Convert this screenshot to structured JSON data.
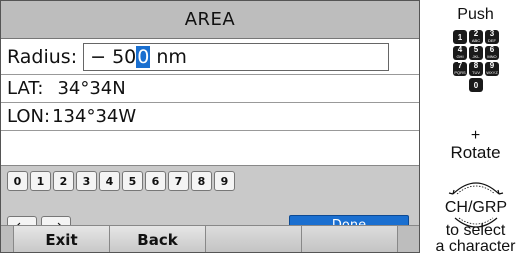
{
  "screen": {
    "title": "AREA",
    "radius_label": "Radius:",
    "radius_value_before": "− 50",
    "radius_value_cursor": "0",
    "radius_unit": " nm",
    "lat_label": "LAT:",
    "lat_value": "34°34N",
    "lon_label": "LON:",
    "lon_value": "134°34W",
    "digits": [
      "0",
      "1",
      "2",
      "3",
      "4",
      "5",
      "6",
      "7",
      "8",
      "9"
    ],
    "left_arrow": "←",
    "right_arrow": "→",
    "done_label": "Done",
    "softkeys": [
      "Exit",
      "Back",
      "",
      ""
    ]
  },
  "side": {
    "push_label": "Push",
    "keypad": [
      [
        {
          "n": "1",
          "s": ""
        },
        {
          "n": "2",
          "s": "ABC"
        },
        {
          "n": "3",
          "s": "DEF"
        }
      ],
      [
        {
          "n": "4",
          "s": "GHI"
        },
        {
          "n": "5",
          "s": "JKL"
        },
        {
          "n": "6",
          "s": "MNO"
        }
      ],
      [
        {
          "n": "7",
          "s": "PQRS"
        },
        {
          "n": "8",
          "s": "TUV"
        },
        {
          "n": "9",
          "s": "WXYZ"
        }
      ],
      [
        {
          "n": "0",
          "s": ""
        }
      ]
    ],
    "plus": "+",
    "rotate_label": "Rotate",
    "dial_label": "CH/GRP",
    "select_line1": "to select",
    "select_line2": "a character"
  },
  "colors": {
    "accent": "#1a6fd0",
    "title_bar": "#bdbdbd",
    "keypad_bg": "#c9c9c9"
  }
}
